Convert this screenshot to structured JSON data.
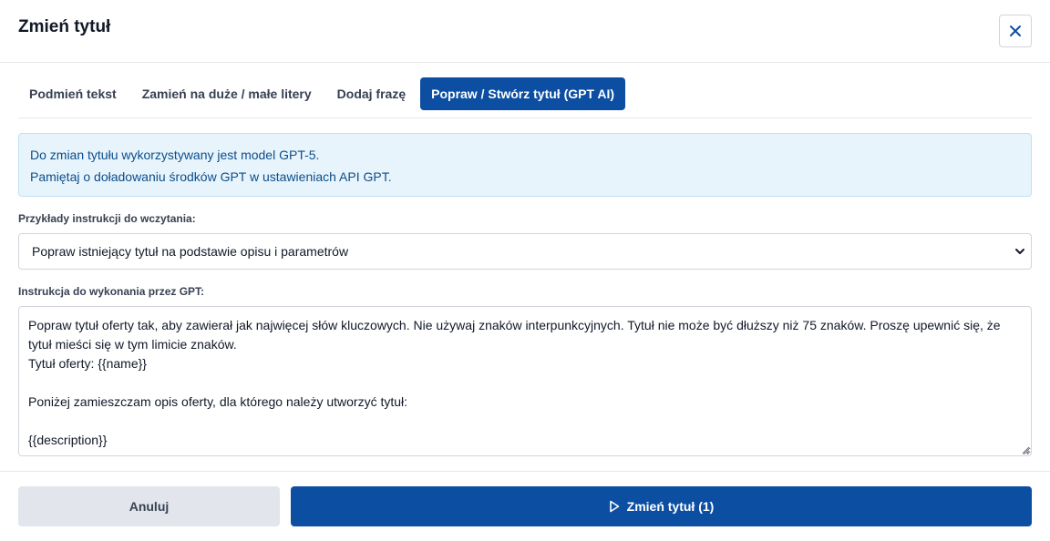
{
  "dialog": {
    "title": "Zmień tytuł",
    "close_icon": "close-icon"
  },
  "tabs": [
    {
      "label": "Podmień tekst",
      "active": false
    },
    {
      "label": "Zamień na duże / małe litery",
      "active": false
    },
    {
      "label": "Dodaj frazę",
      "active": false
    },
    {
      "label": "Popraw / Stwórz tytuł (GPT AI)",
      "active": true
    }
  ],
  "alert": {
    "line1": "Do zmian tytułu wykorzystywany jest model GPT-5.",
    "line2": "Pamiętaj o doładowaniu środków GPT w ustawieniach API GPT."
  },
  "examples": {
    "label": "Przykłady instrukcji do wczytania:",
    "selected": "Popraw istniejący tytuł na podstawie opisu i parametrów"
  },
  "instruction": {
    "label": "Instrukcja do wykonania przez GPT:",
    "value": "Popraw tytuł oferty tak, aby zawierał jak najwięcej słów kluczowych. Nie używaj znaków interpunkcyjnych. Tytuł nie może być dłuższy niż 75 znaków. Proszę upewnić się, że tytuł mieści się w tym limicie znaków.\nTytuł oferty: {{name}}\n\nPoniżej zamieszczam opis oferty, dla którego należy utworzyć tytuł:\n\n{{description}}"
  },
  "footer": {
    "cancel_label": "Anuluj",
    "submit_label": "Zmień tytuł (1)",
    "submit_icon": "play-icon"
  },
  "colors": {
    "primary": "#0b4ea2",
    "alert_bg": "#e8f4fc",
    "alert_text": "#0b4e8a",
    "cancel_bg": "#e2e6ec"
  }
}
